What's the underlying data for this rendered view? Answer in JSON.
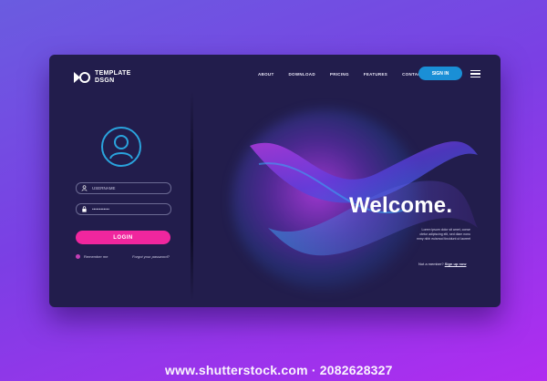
{
  "brand": {
    "line1": "TEMPLATE",
    "line2": "DSGN",
    "icon": "logo-mark"
  },
  "nav": [
    {
      "label": "ABOUT"
    },
    {
      "label": "DOWNLOAD"
    },
    {
      "label": "PRICING"
    },
    {
      "label": "FEATURES"
    },
    {
      "label": "CONTACT"
    }
  ],
  "header": {
    "signin_label": "SIGN IN",
    "menu_icon": "hamburger-menu-icon"
  },
  "login": {
    "avatar_icon": "user-avatar-icon",
    "username_placeholder": "USERNAME",
    "username_icon": "person-icon",
    "password_value": "••••••••••••",
    "password_icon": "lock-icon",
    "button_label": "LOGIN",
    "remember_label": "Remember me",
    "forgot_label": "Forgot your password?"
  },
  "hero": {
    "title": "Welcome.",
    "body_lines": [
      "Lorem ipsum dolor sit amet, conse",
      "ctetur adipiscing elit, sed diam nonu",
      "mmy nibh euismod tincidunt ut laoreet"
    ],
    "signup_prefix": "Not a member?",
    "signup_link": "Sign up now"
  },
  "watermark": "www.shutterstock.com · 2082628327",
  "colors": {
    "card": "#221d4c",
    "accent_blue": "#1a8fd6",
    "accent_pink": "#f0269e"
  }
}
